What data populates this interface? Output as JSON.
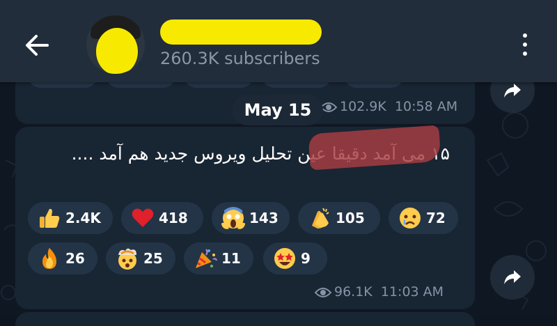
{
  "header": {
    "subscribers": "260.3K subscribers",
    "back_icon": "arrow-left-icon",
    "menu_icon": "more-vertical-icon"
  },
  "previous_message": {
    "views": "102.9K",
    "time": "10:58 AM"
  },
  "date_separator": "May 15",
  "message": {
    "text": "۱۵ می آمد دقیقا عین تحلیل ویروس جدید هم آمد ....",
    "highlighted_text": "۱۵ می آمد",
    "views": "96.1K",
    "time": "11:03 AM",
    "reactions": [
      {
        "emoji": "thumbs-up-icon",
        "count": "2.4K"
      },
      {
        "emoji": "red-heart-icon",
        "count": "418"
      },
      {
        "emoji": "screaming-face-icon",
        "count": "143"
      },
      {
        "emoji": "clapping-hands-icon",
        "count": "105"
      },
      {
        "emoji": "crying-face-icon",
        "count": "72"
      },
      {
        "emoji": "fire-icon",
        "count": "26"
      },
      {
        "emoji": "exploding-head-icon",
        "count": "25"
      },
      {
        "emoji": "party-popper-icon",
        "count": "11"
      },
      {
        "emoji": "star-struck-icon",
        "count": "9"
      }
    ]
  },
  "colors": {
    "header_bg": "#212d3b",
    "bubble_bg": "#182533",
    "reaction_bg": "#243447",
    "muted_text": "#8595a6",
    "redaction": "#f7ea00",
    "highlight": "#a83e42"
  }
}
